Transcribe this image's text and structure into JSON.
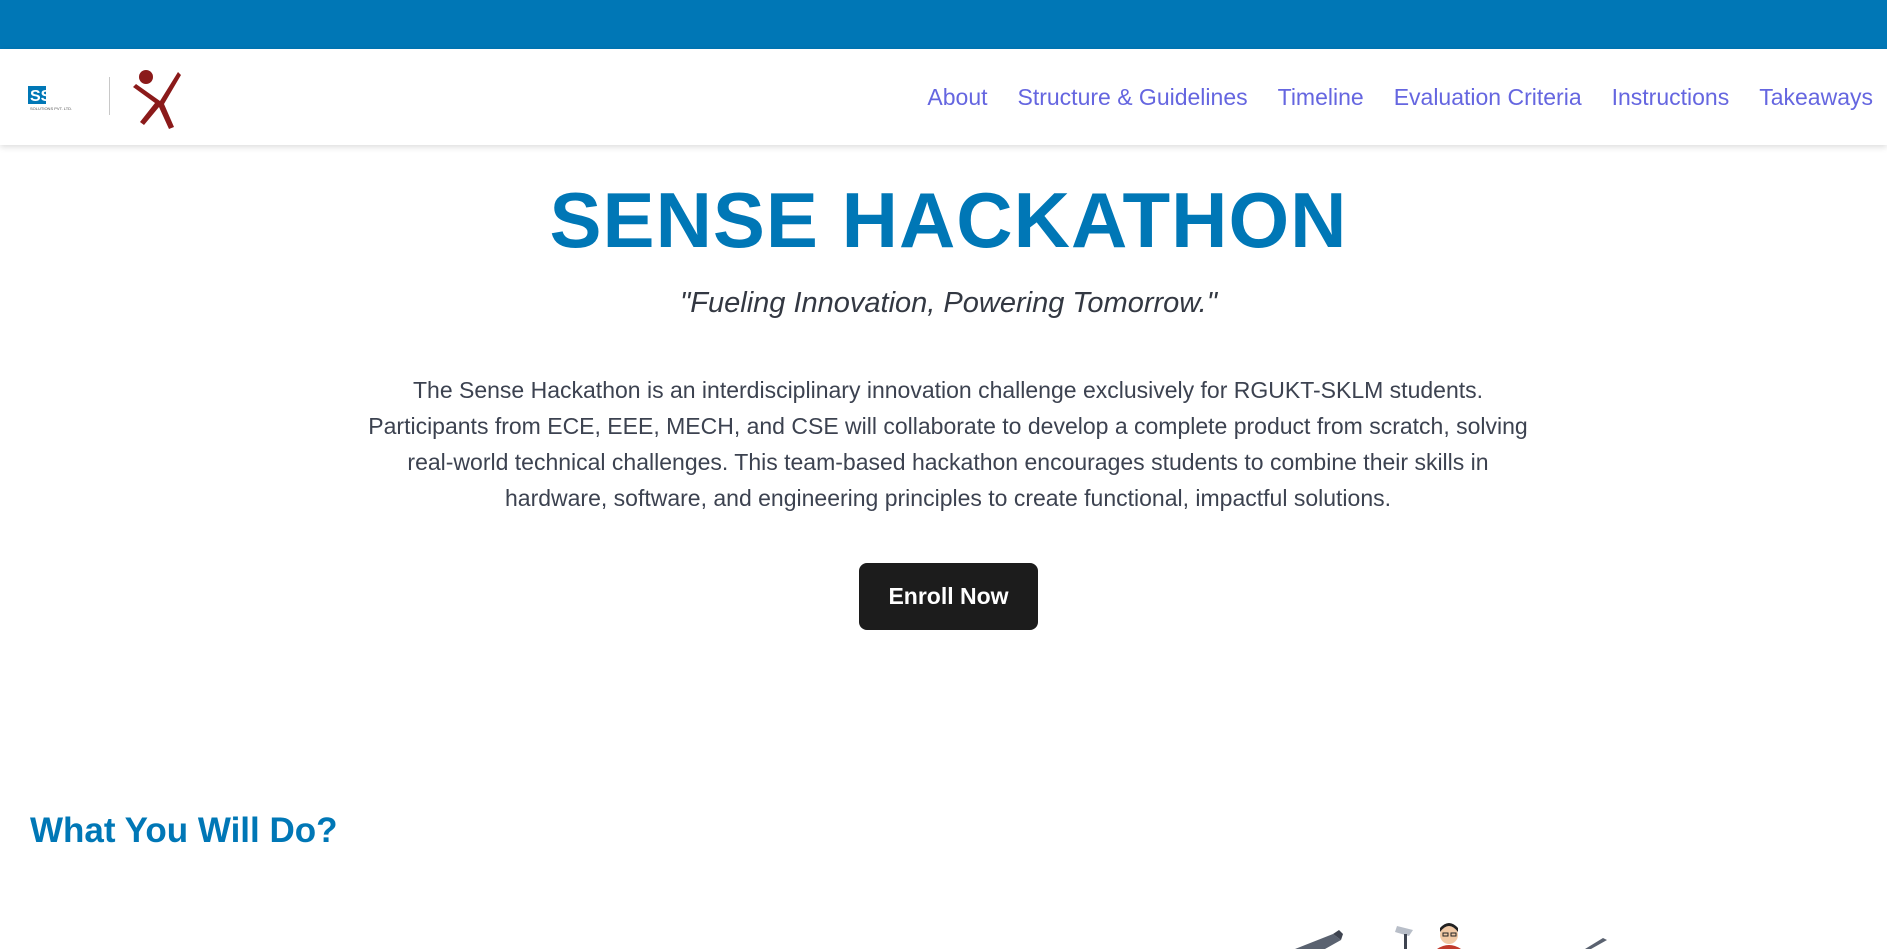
{
  "header": {
    "brand_logo_text": "SSiT",
    "brand_logo_subtext": "SOLUTIONS PVT. LTD.",
    "nav": [
      {
        "label": "About"
      },
      {
        "label": "Structure & Guidelines"
      },
      {
        "label": "Timeline"
      },
      {
        "label": "Evaluation Criteria"
      },
      {
        "label": "Instructions"
      },
      {
        "label": "Takeaways"
      }
    ]
  },
  "hero": {
    "title": "SENSE HACKATHON",
    "tagline": "\"Fueling Innovation, Powering Tomorrow.\"",
    "description": "The Sense Hackathon is an interdisciplinary innovation challenge exclusively for RGUKT-SKLM students. Participants from ECE, EEE, MECH, and CSE will collaborate to develop a complete product from scratch, solving real-world technical challenges. This team-based hackathon encourages students to combine their skills in hardware, software, and engineering principles to create functional, impactful solutions.",
    "cta_label": "Enroll Now"
  },
  "section": {
    "heading": "What You Will Do?"
  },
  "colors": {
    "primary": "#0077b6",
    "nav_link": "#6566e0",
    "button_bg": "#1c1c1c",
    "logo_red": "#8b1a1a"
  },
  "icons": {
    "ssit_logo": "ssit-logo-icon",
    "x_logo": "running-figure-logo-icon"
  }
}
